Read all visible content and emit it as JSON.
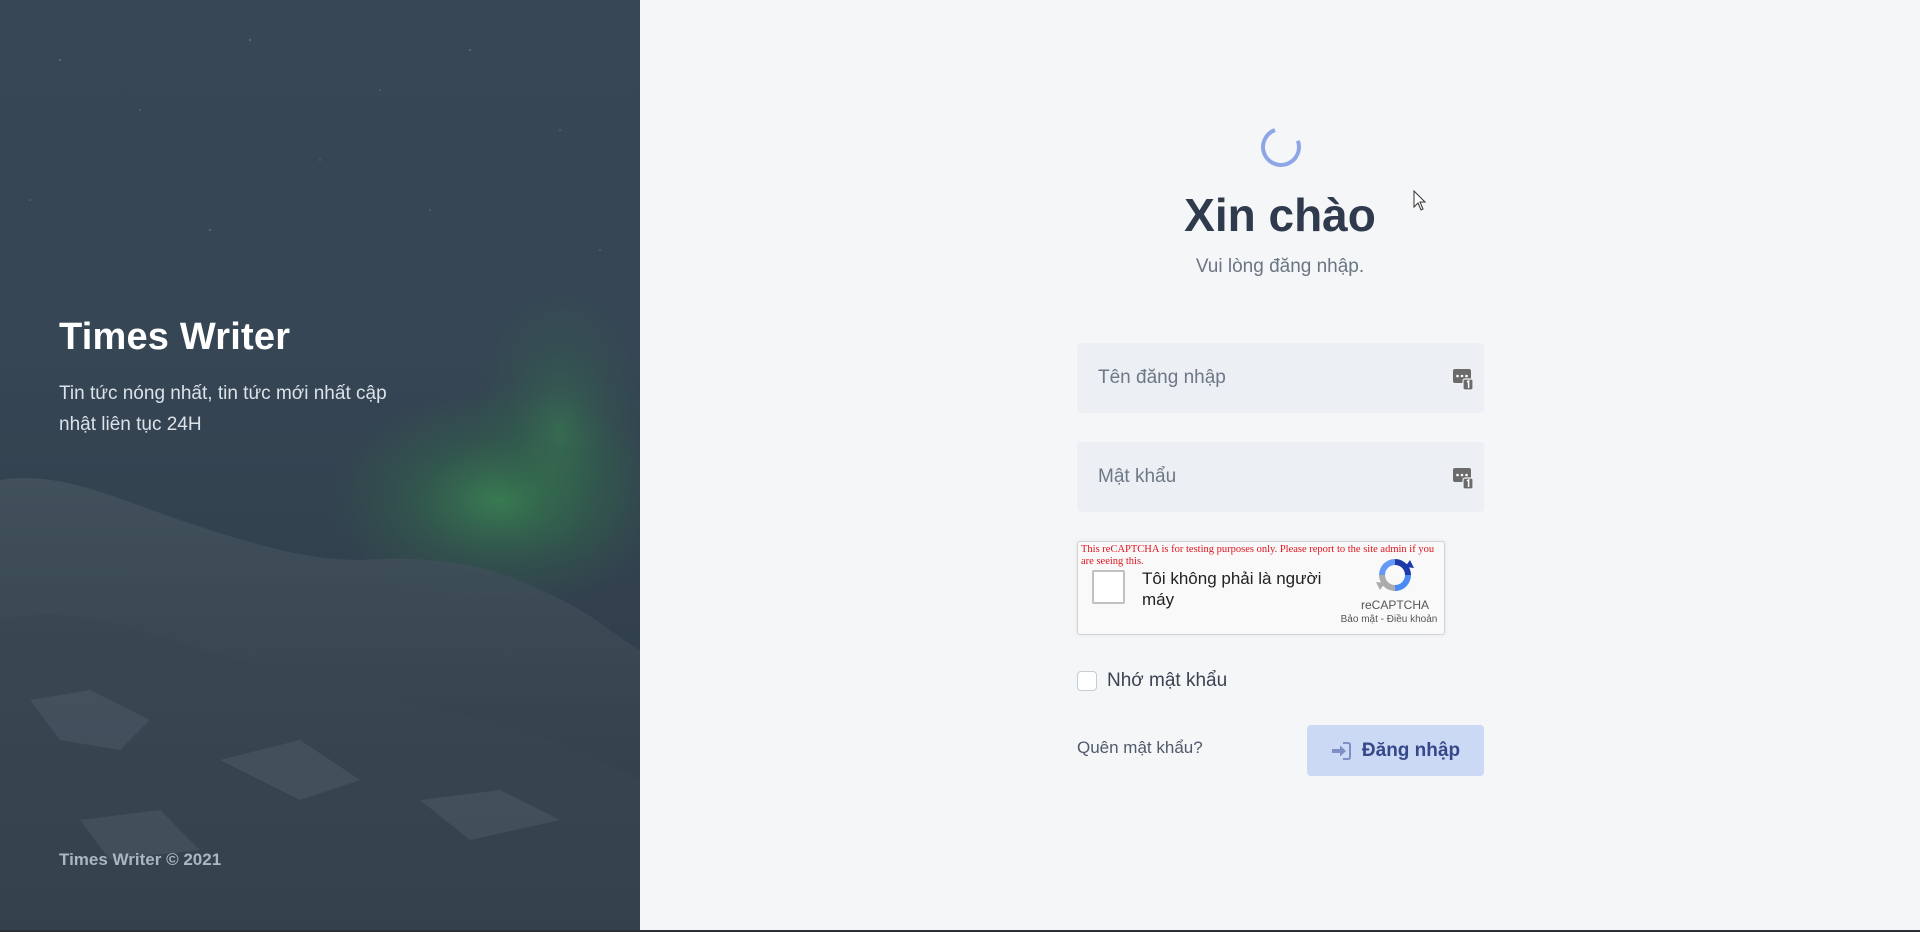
{
  "hero": {
    "brand": "Times Writer",
    "tagline": "Tin tức nóng nhất, tin tức mới nhất cập nhật liên tục 24H",
    "footer": "Times Writer © 2021"
  },
  "header": {
    "title": "Xin chào",
    "subtitle": "Vui lòng đăng nhập."
  },
  "form": {
    "username": {
      "placeholder": "Tên đăng nhập",
      "value": "",
      "icon": "password-manager-icon"
    },
    "password": {
      "placeholder": "Mật khẩu",
      "value": "",
      "icon": "password-manager-icon"
    },
    "recaptcha": {
      "warning": "This reCAPTCHA is for testing purposes only. Please report to the site admin if you are seeing this.",
      "label": "Tôi không phải là người máy",
      "brand": "reCAPTCHA",
      "links": "Bảo mật - Điều khoản",
      "checked": false
    },
    "remember": {
      "label": "Nhớ mật khẩu",
      "checked": false
    },
    "forgot_label": "Quên mật khẩu?",
    "login_label": "Đăng nhập"
  },
  "colors": {
    "accent": "#ccd9f5",
    "accent_text": "#34488a",
    "spinner": "#8fa6e6",
    "heading": "#2f3a4d"
  }
}
